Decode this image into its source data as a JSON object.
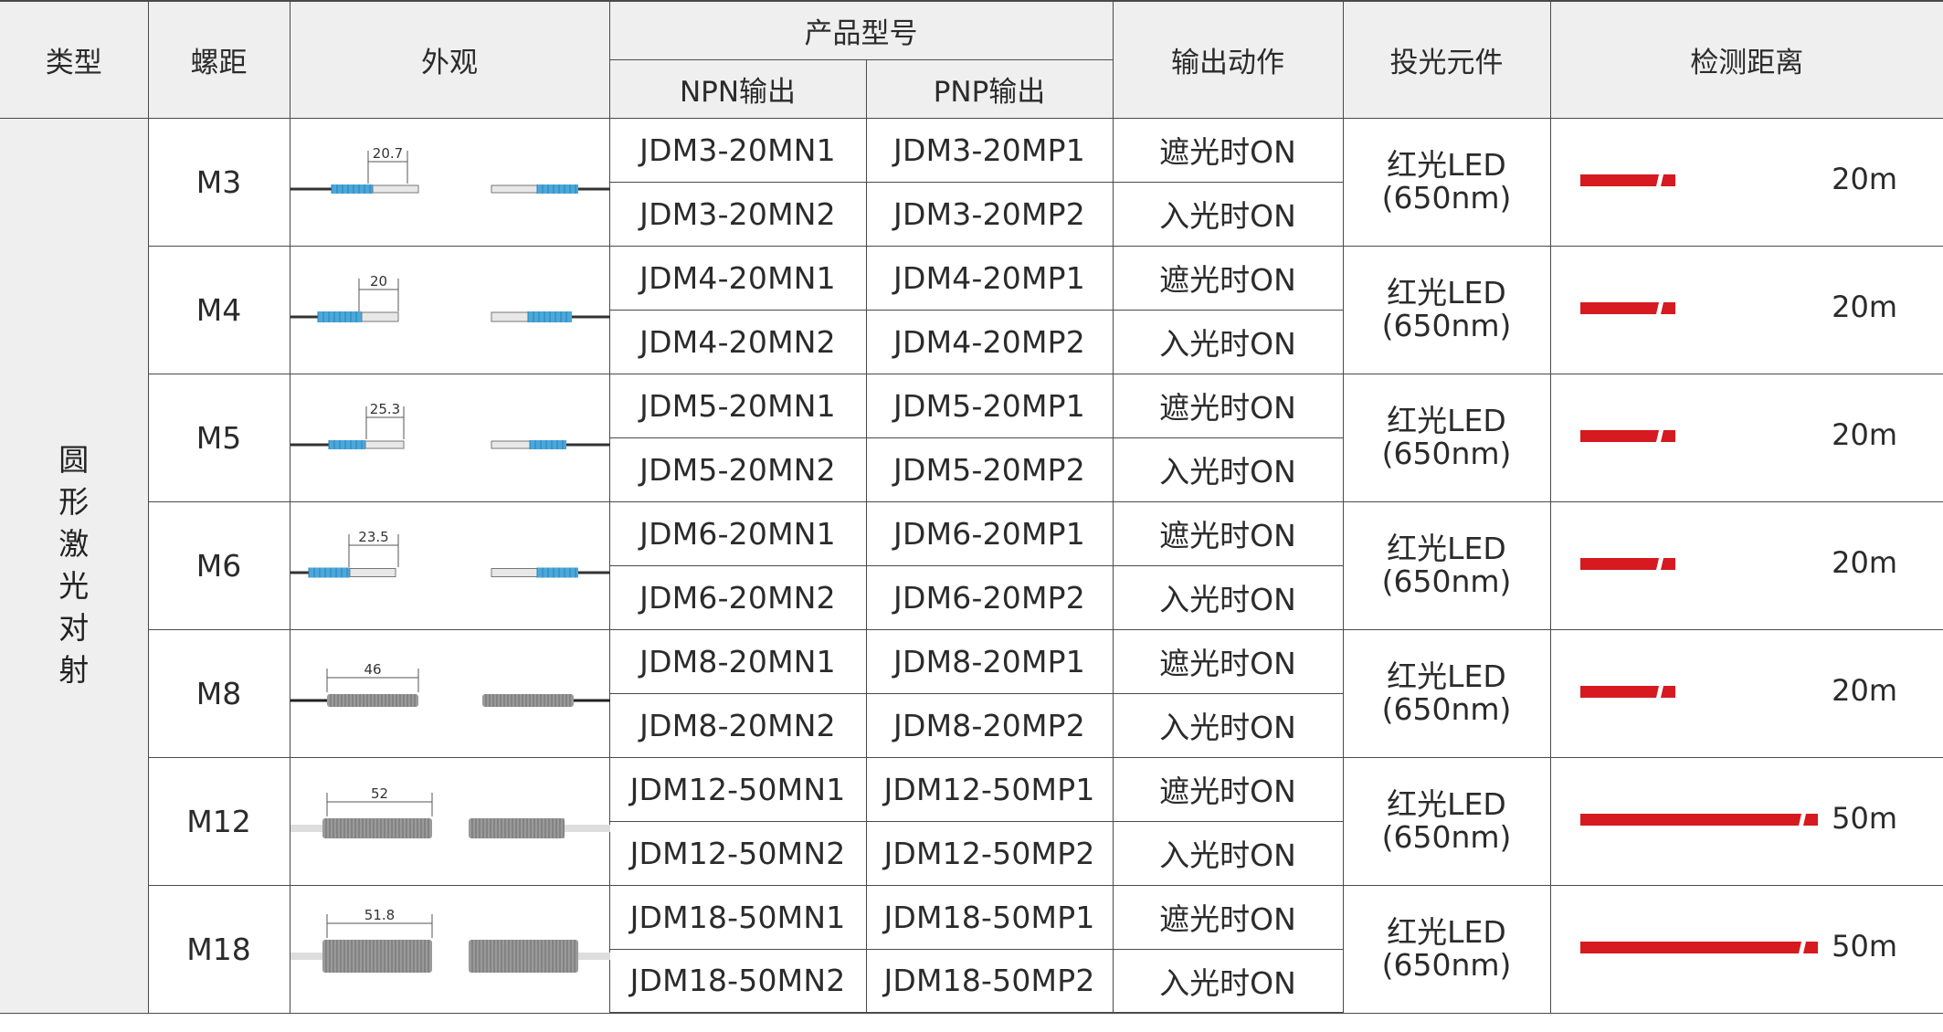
{
  "headers": {
    "type": "类型",
    "pitch": "螺距",
    "appearance": "外观",
    "model_group": "产品型号",
    "npn": "NPN输出",
    "pnp": "PNP输出",
    "action": "输出动作",
    "emitter": "投光元件",
    "distance": "检测距离"
  },
  "type_label": "圆形激光对射",
  "colors": {
    "beam": "#d71920",
    "ring_blue": "#4aa8dc",
    "metal": "#9a9a9a",
    "header_bg": "#efefef"
  },
  "rows": [
    {
      "pitch": "M3",
      "dim": "20.7",
      "npn1": "JDM3-20MN1",
      "pnp1": "JDM3-20MP1",
      "npn2": "JDM3-20MN2",
      "pnp2": "JDM3-20MP2",
      "action1": "遮光时ON",
      "action2": "入光时ON",
      "emitter1": "红光LED",
      "emitter2": "(650nm)",
      "distance": "20m",
      "beam_fraction": 0.28,
      "style": "blue"
    },
    {
      "pitch": "M4",
      "dim": "20",
      "npn1": "JDM4-20MN1",
      "pnp1": "JDM4-20MP1",
      "npn2": "JDM4-20MN2",
      "pnp2": "JDM4-20MP2",
      "action1": "遮光时ON",
      "action2": "入光时ON",
      "emitter1": "红光LED",
      "emitter2": "(650nm)",
      "distance": "20m",
      "beam_fraction": 0.28,
      "style": "blue"
    },
    {
      "pitch": "M5",
      "dim": "25.3",
      "npn1": "JDM5-20MN1",
      "pnp1": "JDM5-20MP1",
      "npn2": "JDM5-20MN2",
      "pnp2": "JDM5-20MP2",
      "action1": "遮光时ON",
      "action2": "入光时ON",
      "emitter1": "红光LED",
      "emitter2": "(650nm)",
      "distance": "20m",
      "beam_fraction": 0.28,
      "style": "blue"
    },
    {
      "pitch": "M6",
      "dim": "23.5",
      "npn1": "JDM6-20MN1",
      "pnp1": "JDM6-20MP1",
      "npn2": "JDM6-20MN2",
      "pnp2": "JDM6-20MP2",
      "action1": "遮光时ON",
      "action2": "入光时ON",
      "emitter1": "红光LED",
      "emitter2": "(650nm)",
      "distance": "20m",
      "beam_fraction": 0.28,
      "style": "blue"
    },
    {
      "pitch": "M8",
      "dim": "46",
      "npn1": "JDM8-20MN1",
      "pnp1": "JDM8-20MP1",
      "npn2": "JDM8-20MN2",
      "pnp2": "JDM8-20MP2",
      "action1": "遮光时ON",
      "action2": "入光时ON",
      "emitter1": "红光LED",
      "emitter2": "(650nm)",
      "distance": "20m",
      "beam_fraction": 0.28,
      "style": "metal"
    },
    {
      "pitch": "M12",
      "dim": "52",
      "npn1": "JDM12-50MN1",
      "pnp1": "JDM12-50MP1",
      "npn2": "JDM12-50MN2",
      "pnp2": "JDM12-50MP2",
      "action1": "遮光时ON",
      "action2": "入光时ON",
      "emitter1": "红光LED",
      "emitter2": "(650nm)",
      "distance": "50m",
      "beam_fraction": 0.7,
      "style": "metal-big"
    },
    {
      "pitch": "M18",
      "dim": "51.8",
      "npn1": "JDM18-50MN1",
      "pnp1": "JDM18-50MP1",
      "npn2": "JDM18-50MN2",
      "pnp2": "JDM18-50MP2",
      "action1": "遮光时ON",
      "action2": "入光时ON",
      "emitter1": "红光LED",
      "emitter2": "(650nm)",
      "distance": "50m",
      "beam_fraction": 0.7,
      "style": "metal-huge"
    }
  ]
}
